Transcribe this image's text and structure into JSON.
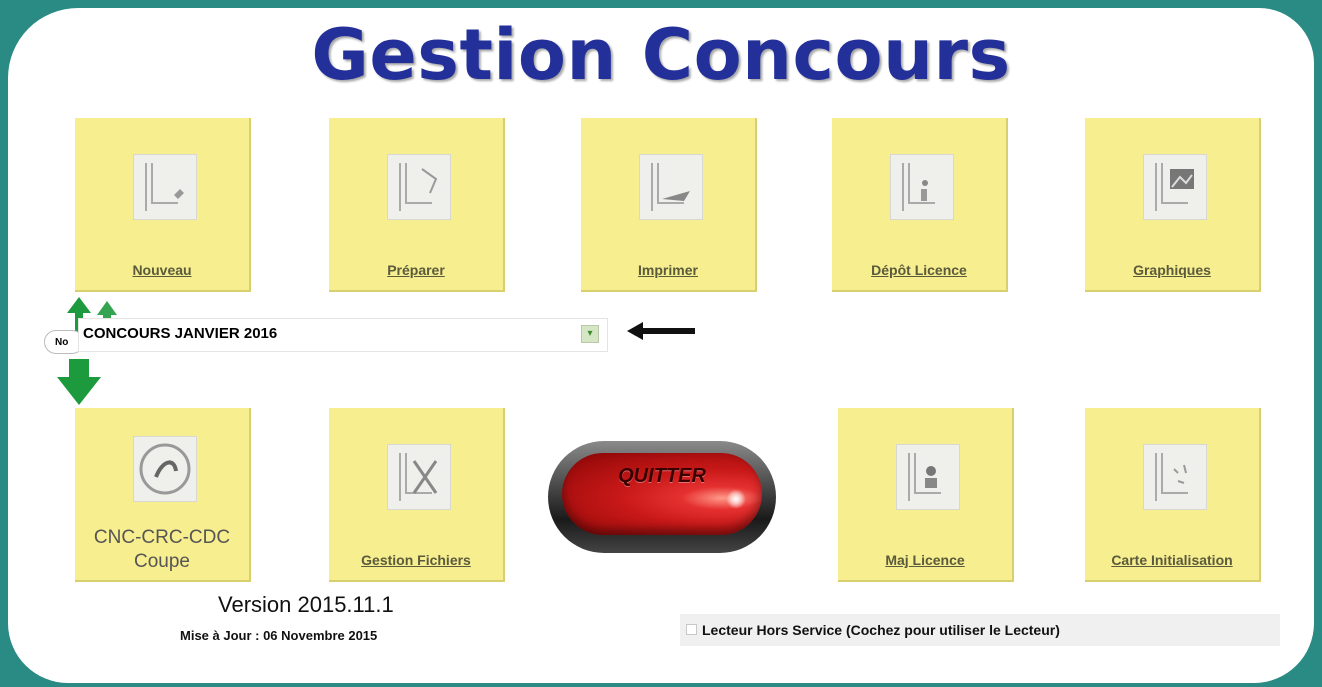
{
  "title": "Gestion Concours",
  "top_tiles": [
    {
      "label": "Nouveau"
    },
    {
      "label": "Préparer"
    },
    {
      "label": "Imprimer"
    },
    {
      "label": "Dépôt Licence"
    },
    {
      "label": "Graphiques"
    }
  ],
  "bottom_tiles": [
    {
      "label_line1": "CNC-CRC-CDC",
      "label_line2": "Coupe"
    },
    {
      "label": "Gestion Fichiers"
    },
    {
      "label": "Maj Licence"
    },
    {
      "label": "Carte Initialisation"
    }
  ],
  "concours_select": {
    "value": "CONCOURS JANVIER 2016",
    "tag": "No"
  },
  "quit_button": {
    "label": "QUITTER"
  },
  "version": "Version 2015.11.1",
  "maj": "Mise à Jour : 06 Novembre 2015",
  "reader_option": {
    "label": "Lecteur Hors Service (Cochez pour utiliser le Lecteur)",
    "checked": false
  },
  "colors": {
    "title": "#24309a",
    "tile": "#f7ee8f",
    "frame": "#2a8a84",
    "arrow_green": "#1e9a3e"
  }
}
